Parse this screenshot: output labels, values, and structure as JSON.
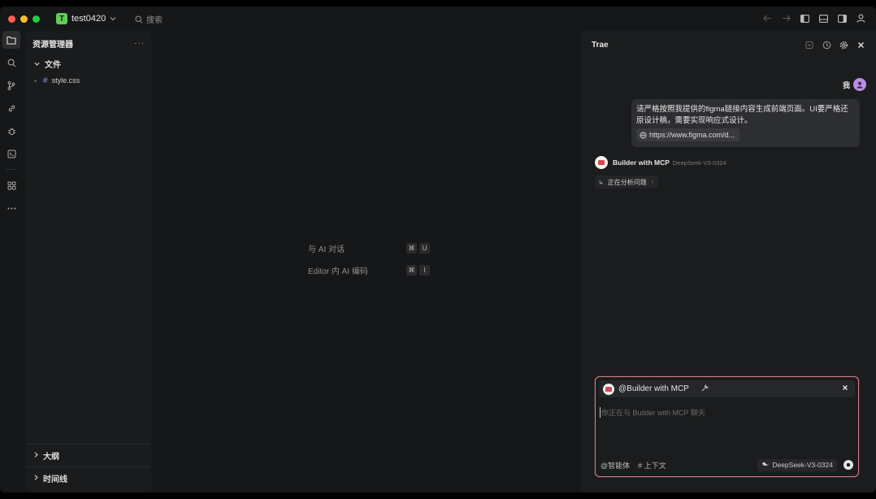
{
  "project": {
    "badge": "T",
    "name": "test0420"
  },
  "search": {
    "placeholder": "搜索"
  },
  "colors": {
    "close": "#fe5f57",
    "minimize": "#febc2e",
    "maximize": "#28c840",
    "accent_border": "#d77a8a"
  },
  "explorer": {
    "title": "资源管理器",
    "more": "···",
    "folder": "文件",
    "files": [
      "style.css"
    ],
    "sections": [
      "大纲",
      "时间线"
    ]
  },
  "editor": {
    "hints": [
      {
        "label": "与 AI 对话",
        "keys": [
          "⌘",
          "U"
        ]
      },
      {
        "label": "Editor 内 AI 编码",
        "keys": [
          "⌘",
          "I"
        ]
      }
    ]
  },
  "chat": {
    "title": "Trae",
    "user_label": "我",
    "message": "请严格按照我提供的figma链接内容生成前端页面。UI要严格还原设计稿，需要实现响应式设计。",
    "link": "https://www.figma.com/d...",
    "agent_name": "Builder with MCP",
    "agent_model": "DeepSeek-V3-0324",
    "status": "正在分析问题",
    "input": {
      "mention": "@Builder with MCP",
      "placeholder": "你正在与 Builder with MCP 聊天",
      "agent_button": "@智能体",
      "context_button": "# 上下文",
      "model": "DeepSeek-V3-0324"
    }
  }
}
